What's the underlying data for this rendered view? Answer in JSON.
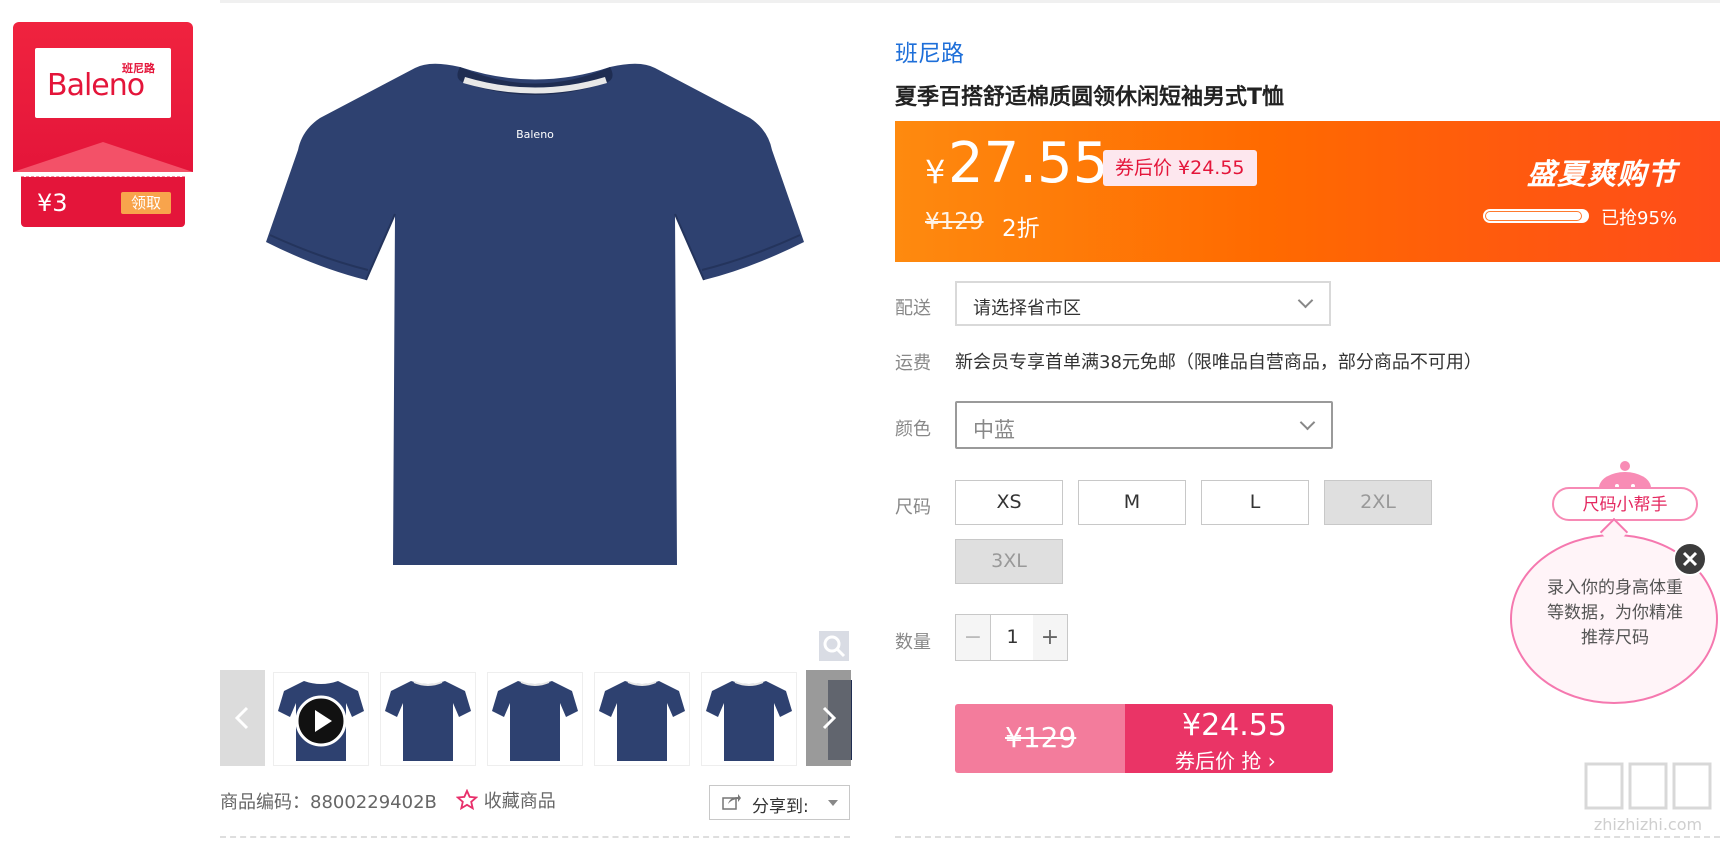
{
  "coupon": {
    "brand": "Baleno",
    "brand_cn": "班尼路",
    "amount": "¥3",
    "claim_label": "领取"
  },
  "gallery": {
    "thumb_count": 6,
    "product_color": "#2e4170"
  },
  "meta": {
    "sku_label": "商品编码：8800229402B",
    "favorite_label": "收藏商品",
    "share_label": "分享到:"
  },
  "product": {
    "brand": "班尼路",
    "title": "夏季百搭舒适棉质圆领休闲短袖男式T恤"
  },
  "price": {
    "currency": "¥",
    "current": "27.55",
    "coupon_price": "券后价 ¥24.55",
    "original": "¥129",
    "discount": "2折",
    "festival": "盛夏爽购节",
    "sold_progress": 0.95,
    "sold_text": "已抢95%"
  },
  "delivery": {
    "label": "配送",
    "value": "请选择省市区"
  },
  "shipping": {
    "label": "运费",
    "value": "新会员专享首单满38元免邮（限唯品自营商品，部分商品不可用）"
  },
  "color": {
    "label": "颜色",
    "value": "中蓝"
  },
  "size": {
    "label": "尺码",
    "options": [
      {
        "label": "XS",
        "available": true
      },
      {
        "label": "M",
        "available": true
      },
      {
        "label": "L",
        "available": true
      },
      {
        "label": "2XL",
        "available": false
      },
      {
        "label": "3XL",
        "available": false
      }
    ]
  },
  "quantity": {
    "label": "数量",
    "value": "1",
    "minus": "−",
    "plus": "+"
  },
  "buy": {
    "original": "¥129",
    "price": "¥24.55",
    "action": "券后价 抢 ›"
  },
  "helper": {
    "title": "尺码小帮手",
    "text": "录入你的身高体重等数据，为你精准推荐尺码"
  },
  "watermark": {
    "text": "zhizhizhi.com"
  },
  "colors": {
    "brand_red": "#e4153a",
    "banner_orange": "#ff6a00",
    "buy_pink": "#ea3466",
    "link_blue": "#1e6fd9"
  }
}
